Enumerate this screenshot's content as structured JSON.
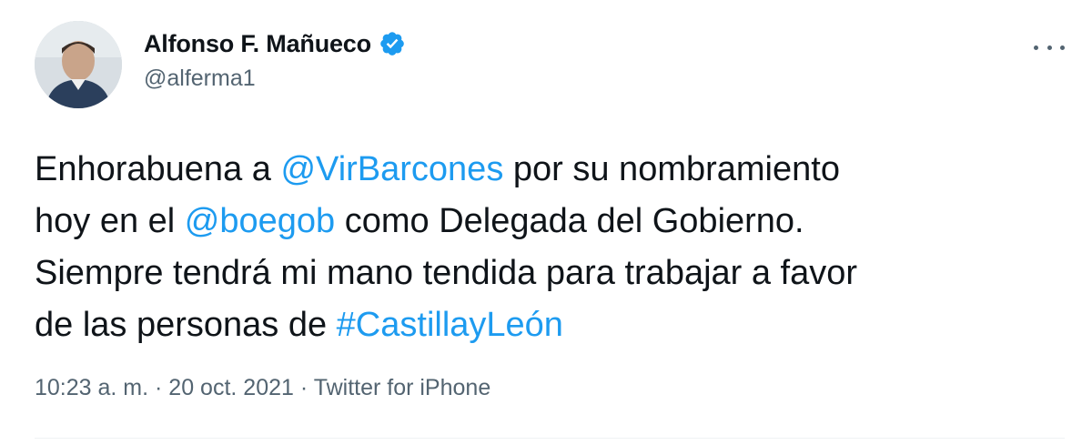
{
  "tweet": {
    "author": {
      "display_name": "Alfonso F. Mañueco",
      "handle": "@alferma1",
      "verified": true
    },
    "text": {
      "part1": "Enhorabuena a ",
      "mention1": "@VirBarcones",
      "part2": " por su nombramiento\nhoy en el ",
      "mention2": "@boegob",
      "part3": " como Delegada del Gobierno.\nSiempre tendrá mi mano tendida para trabajar a favor\nde las personas de ",
      "hashtag": "#CastillayLeón"
    },
    "meta": {
      "time": "10:23 a. m.",
      "separator": " · ",
      "date": "20 oct. 2021",
      "source": "Twitter for iPhone"
    }
  },
  "colors": {
    "link": "#1d9bf0",
    "text": "#0f1419",
    "secondary": "#536471",
    "verified_badge": "#1d9bf0"
  },
  "icons": {
    "verified": "verified-badge-icon",
    "more": "more-options-icon"
  }
}
